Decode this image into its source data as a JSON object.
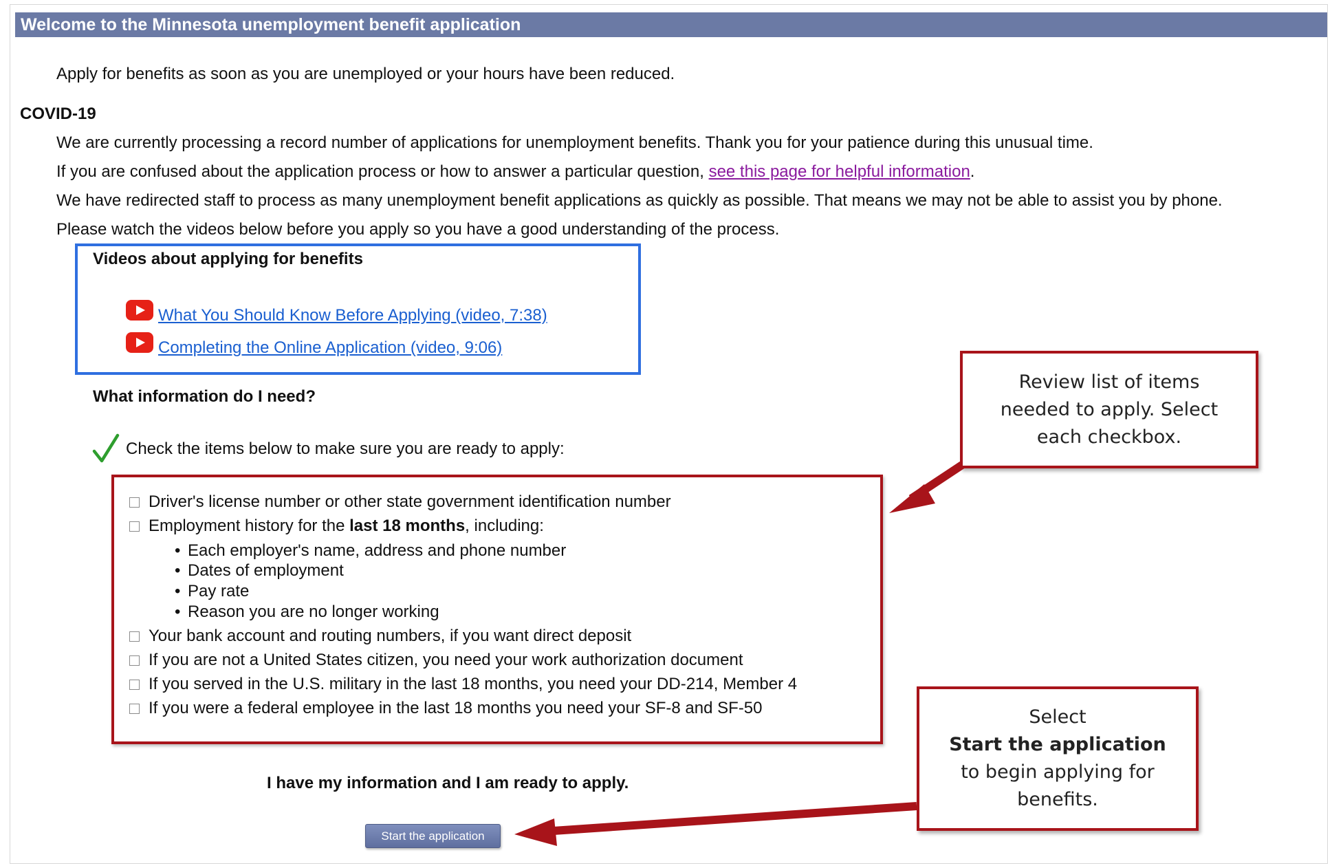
{
  "header": {
    "title": "Welcome to the Minnesota unemployment benefit application"
  },
  "intro": {
    "text": "Apply for benefits as soon as you are unemployed or your hours have been reduced."
  },
  "covid": {
    "heading": "COVID-19",
    "line1": "We are currently processing a record number of applications for unemployment benefits. Thank you for your patience during this unusual time.",
    "line2_prefix": "If you are confused about the application process or how to answer a particular question, ",
    "line2_link": "see this page for helpful information",
    "line2_suffix": ".",
    "line3": "We have redirected staff to process as many unemployment benefit applications as quickly as possible. That means we may not be able to assist you by phone.",
    "line4": "Please watch the videos below before you apply so you have a good understanding of the process."
  },
  "videos": {
    "heading": "Videos about applying for benefits",
    "items": [
      {
        "label": "What You Should Know Before Applying (video, 7:38)",
        "icon": "youtube-icon"
      },
      {
        "label": "Completing the Online Application (video, 9:06)",
        "icon": "youtube-icon"
      }
    ]
  },
  "info": {
    "heading": "What information do I need?",
    "check_text": "Check the items below to make sure you are ready to apply:",
    "checkmark_color": "#2e9e2e"
  },
  "checklist": {
    "item1": "Driver's license number or other state government identification number",
    "item2_prefix": "Employment history for the ",
    "item2_bold": "last 18 months",
    "item2_suffix": ", including:",
    "subitems": [
      "Each employer's name, address and phone number",
      "Dates of employment",
      "Pay rate",
      "Reason you are no longer working"
    ],
    "item3": "Your bank account and routing numbers, if you want direct deposit",
    "item4": "If you are not a United States citizen, you need your work authorization document",
    "item5": "If you served in the U.S. military in the last 18 months, you need your DD-214, Member 4",
    "item6": "If you were a federal employee in the last 18 months you need your SF-8 and SF-50"
  },
  "ready": {
    "text": "I have my information and I am ready to apply."
  },
  "start_button": {
    "label": "Start the application"
  },
  "callouts": {
    "review": {
      "lines": [
        "Review list of items",
        "needed to apply. Select",
        "each checkbox."
      ]
    },
    "start": {
      "line1": "Select",
      "line2_bold": "Start the application",
      "line3": "to begin applying for",
      "line4": "benefits."
    }
  },
  "colors": {
    "header_bg": "#6b7aa5",
    "annotation_red": "#a8141a",
    "video_box_blue": "#2f6fe0",
    "link_blue": "#1a5fd0",
    "link_visited": "#8a1a9e"
  }
}
